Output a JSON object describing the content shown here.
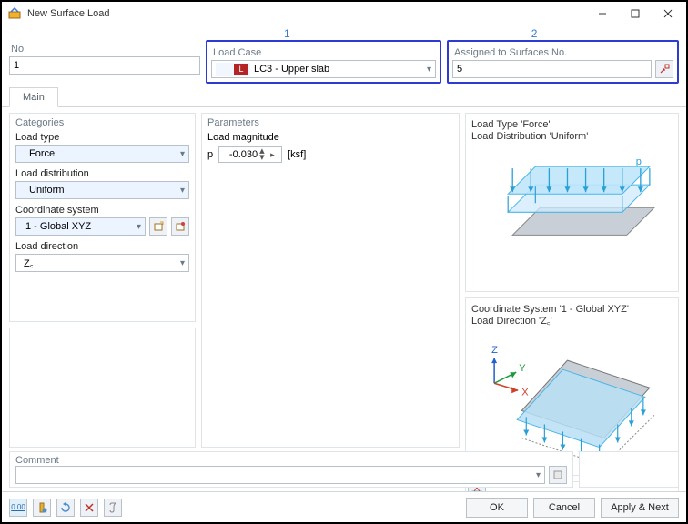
{
  "window_title": "New Surface Load",
  "annotations": {
    "one": "1",
    "two": "2"
  },
  "top": {
    "no_label": "No.",
    "no_value": "1",
    "loadcase_label": "Load Case",
    "loadcase_badge": "L",
    "loadcase_value": "LC3 - Upper slab",
    "assigned_label": "Assigned to Surfaces No.",
    "assigned_value": "5"
  },
  "tabs": {
    "main": "Main"
  },
  "categories": {
    "header": "Categories",
    "load_type_label": "Load type",
    "load_type_value": "Force",
    "load_dist_label": "Load distribution",
    "load_dist_value": "Uniform",
    "coord_label": "Coordinate system",
    "coord_value": "1 - Global XYZ",
    "dir_label": "Load direction",
    "dir_value": "Z꜀"
  },
  "parameters": {
    "header": "Parameters",
    "mag_label": "Load magnitude",
    "p_symbol": "p",
    "p_value": "-0.030",
    "p_unit": "[ksf]"
  },
  "preview": {
    "line1": "Load Type 'Force'",
    "line2": "Load Distribution 'Uniform'",
    "p_label": "p",
    "line3": "Coordinate System '1 - Global XYZ'",
    "line4": "Load Direction 'Z꜀'",
    "axis_z": "Z",
    "axis_y": "Y",
    "axis_x": "X"
  },
  "comment": {
    "header": "Comment",
    "value": ""
  },
  "buttons": {
    "ok": "OK",
    "cancel": "Cancel",
    "apply_next": "Apply & Next"
  }
}
